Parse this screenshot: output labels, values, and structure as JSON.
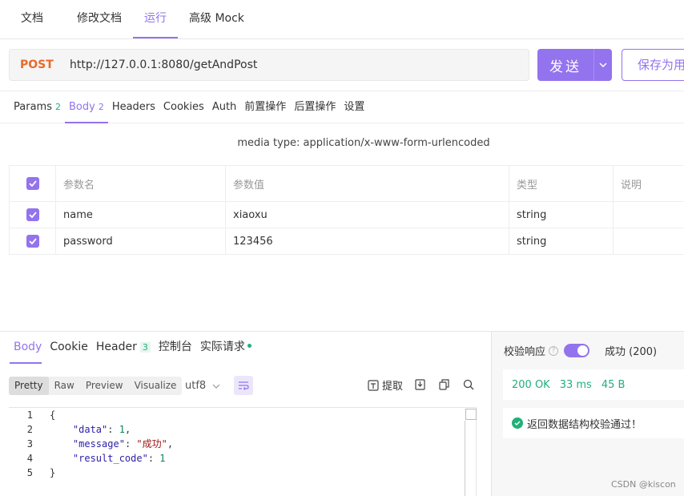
{
  "top_tabs": [
    {
      "label": "文档"
    },
    {
      "label": "修改文档"
    },
    {
      "label": "运行"
    },
    {
      "label": "高级 Mock"
    }
  ],
  "request": {
    "method": "POST",
    "url": "http://127.0.0.1:8080/getAndPost",
    "send_label": "发送",
    "save_label": "保存为用例"
  },
  "req_tabs": {
    "params": {
      "label": "Params",
      "count": "2"
    },
    "body": {
      "label": "Body",
      "count": "2"
    },
    "headers": "Headers",
    "cookies": "Cookies",
    "auth": "Auth",
    "pre": "前置操作",
    "post": "后置操作",
    "settings": "设置"
  },
  "media_type": "media type: application/x-www-form-urlencoded",
  "params_table": {
    "headers": [
      "参数名",
      "参数值",
      "类型",
      "说明"
    ],
    "rows": [
      {
        "name": "name",
        "value": "xiaoxu",
        "type": "string",
        "desc": ""
      },
      {
        "name": "password",
        "value": "123456",
        "type": "string",
        "desc": ""
      }
    ]
  },
  "resp_tabs": {
    "body": "Body",
    "cookie": "Cookie",
    "header": {
      "label": "Header",
      "count": "3"
    },
    "console": "控制台",
    "actual": "实际请求"
  },
  "resp_toolbar": {
    "formats": [
      "Pretty",
      "Raw",
      "Preview",
      "Visualize"
    ],
    "encoding": "utf8",
    "extract": "提取"
  },
  "code": {
    "lines": [
      "1",
      "2",
      "3",
      "4",
      "5"
    ],
    "open": "{",
    "close": "}",
    "entries": [
      {
        "key": "\"data\"",
        "value": "1",
        "sep": ","
      },
      {
        "key": "\"message\"",
        "value": "\"成功\"",
        "sep": ","
      },
      {
        "key": "\"result_code\"",
        "value": "1",
        "sep": ""
      }
    ]
  },
  "validation": {
    "label": "校验响应",
    "status": "成功 (200)",
    "http_status": "200 OK",
    "time": "33 ms",
    "size": "45 B",
    "message": "返回数据结构校验通过！"
  },
  "watermark": "CSDN @kiscon",
  "colors": {
    "accent": "#9373ee",
    "method": "#e86a2c",
    "success": "#21b07a"
  }
}
